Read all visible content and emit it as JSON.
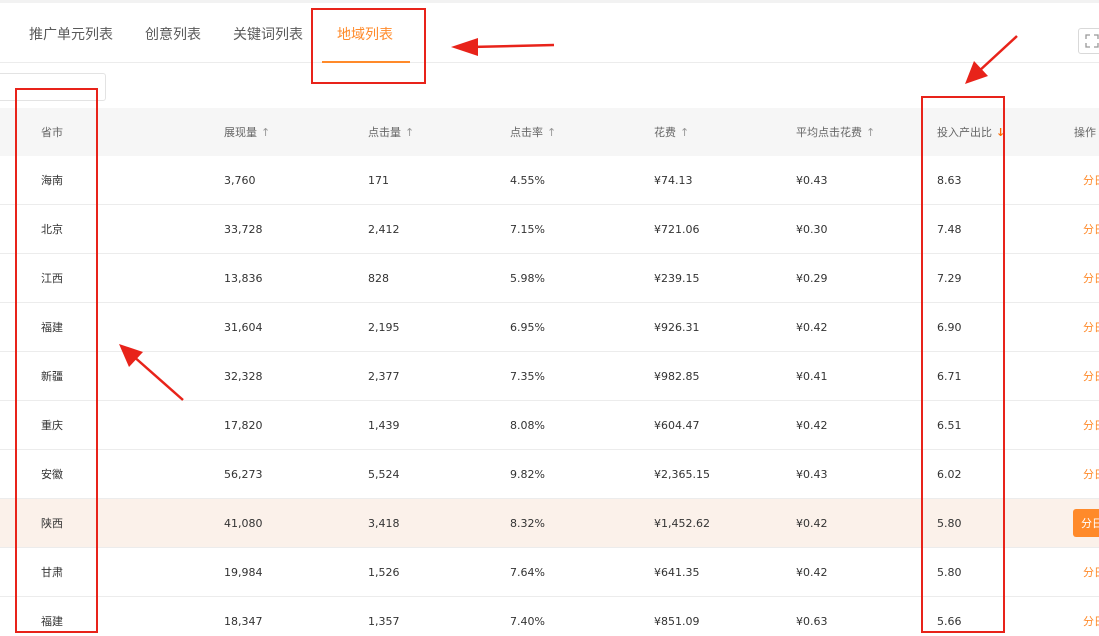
{
  "tabs": [
    {
      "label": "推广单元列表"
    },
    {
      "label": "创意列表"
    },
    {
      "label": "关键词列表"
    },
    {
      "label": "地域列表"
    }
  ],
  "active_tab_index": 3,
  "columns": [
    {
      "label": "省市",
      "sort": ""
    },
    {
      "label": "展现量",
      "sort": "↑"
    },
    {
      "label": "点击量",
      "sort": "↑"
    },
    {
      "label": "点击率",
      "sort": "↑"
    },
    {
      "label": "花费",
      "sort": "↑"
    },
    {
      "label": "平均点击花费",
      "sort": "↑"
    },
    {
      "label": "投入产出比",
      "sort": "↓"
    },
    {
      "label": "操作",
      "sort": ""
    }
  ],
  "rows": [
    {
      "region": "海南",
      "impressions": "3,760",
      "clicks": "171",
      "ctr": "4.55%",
      "cost": "¥74.13",
      "cpc": "¥0.43",
      "roi": "8.63",
      "op": "分日"
    },
    {
      "region": "北京",
      "impressions": "33,728",
      "clicks": "2,412",
      "ctr": "7.15%",
      "cost": "¥721.06",
      "cpc": "¥0.30",
      "roi": "7.48",
      "op": "分日"
    },
    {
      "region": "江西",
      "impressions": "13,836",
      "clicks": "828",
      "ctr": "5.98%",
      "cost": "¥239.15",
      "cpc": "¥0.29",
      "roi": "7.29",
      "op": "分日"
    },
    {
      "region": "福建",
      "impressions": "31,604",
      "clicks": "2,195",
      "ctr": "6.95%",
      "cost": "¥926.31",
      "cpc": "¥0.42",
      "roi": "6.90",
      "op": "分日"
    },
    {
      "region": "新疆",
      "impressions": "32,328",
      "clicks": "2,377",
      "ctr": "7.35%",
      "cost": "¥982.85",
      "cpc": "¥0.41",
      "roi": "6.71",
      "op": "分日"
    },
    {
      "region": "重庆",
      "impressions": "17,820",
      "clicks": "1,439",
      "ctr": "8.08%",
      "cost": "¥604.47",
      "cpc": "¥0.42",
      "roi": "6.51",
      "op": "分日"
    },
    {
      "region": "安徽",
      "impressions": "56,273",
      "clicks": "5,524",
      "ctr": "9.82%",
      "cost": "¥2,365.15",
      "cpc": "¥0.43",
      "roi": "6.02",
      "op": "分日"
    },
    {
      "region": "陕西",
      "impressions": "41,080",
      "clicks": "3,418",
      "ctr": "8.32%",
      "cost": "¥1,452.62",
      "cpc": "¥0.42",
      "roi": "5.80",
      "op": "分日"
    },
    {
      "region": "甘肃",
      "impressions": "19,984",
      "clicks": "1,526",
      "ctr": "7.64%",
      "cost": "¥641.35",
      "cpc": "¥0.42",
      "roi": "5.80",
      "op": "分日"
    },
    {
      "region": "福建",
      "impressions": "18,347",
      "clicks": "1,357",
      "ctr": "7.40%",
      "cost": "¥851.09",
      "cpc": "¥0.63",
      "roi": "5.66",
      "op": "分日"
    }
  ],
  "highlight_row_index": 7,
  "icons": {
    "expand": "expand-icon"
  },
  "colors": {
    "accent": "#ff8a2a",
    "annotation": "#e8231a",
    "highlight_row": "#fbf1ea"
  }
}
